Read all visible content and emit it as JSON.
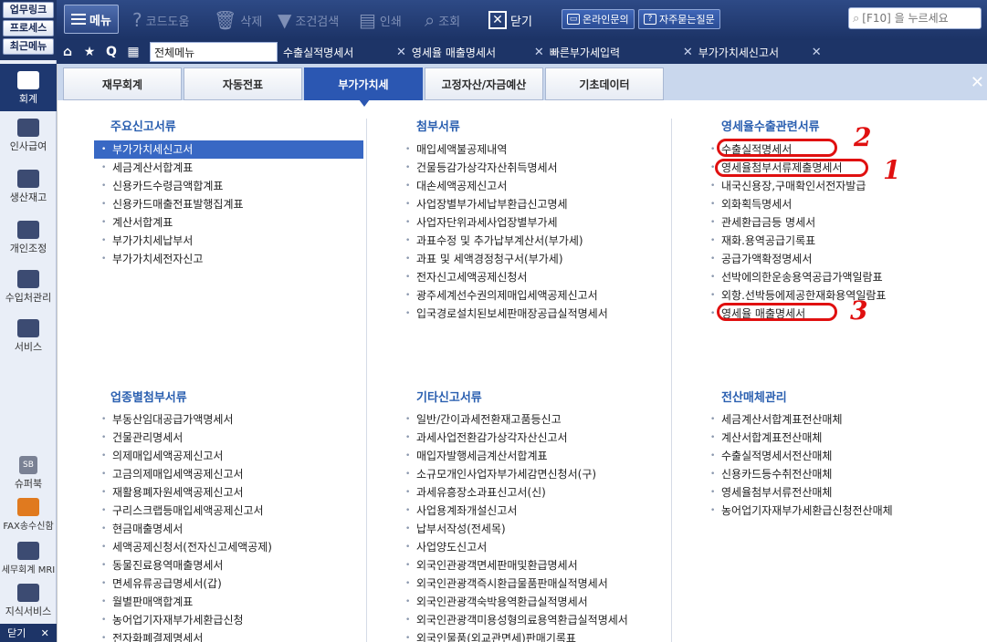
{
  "quick_buttons": [
    "업무링크",
    "프로세스",
    "최근메뉴"
  ],
  "toolbar": {
    "menu_label": "메뉴",
    "code_help": "코드도움",
    "delete": "삭제",
    "filter": "조건검색",
    "print": "인쇄",
    "lookup": "조회",
    "close": "닫기",
    "online_inquiry": "온라인문의",
    "faq": "자주묻는질문",
    "search_placeholder": "[F10] 을 누르세요"
  },
  "tabs": {
    "all_menu": "전체메뉴",
    "docs": [
      "수출실적명세서",
      "영세율 매출명세서",
      "빠른부가세입력",
      "부가가치세신고서"
    ]
  },
  "sidebar": {
    "items": [
      "회계",
      "인사급여",
      "생산재고",
      "개인조정",
      "수입처관리",
      "서비스"
    ],
    "lower": [
      "슈퍼북",
      "FAX송수신함",
      "세무회계 MRI",
      "지식서비스"
    ],
    "superbook_badge": "SB",
    "close_label": "닫기"
  },
  "categories": [
    "재무회계",
    "자동전표",
    "부가가치세",
    "고정자산/자금예산",
    "기초데이터"
  ],
  "sections": {
    "main_returns": {
      "title": "주요신고서류",
      "items": [
        "부가가치세신고서",
        "세금계산서합계표",
        "신용카드수령금액합계표",
        "신용카드매출전표발행집계표",
        "계산서합계표",
        "부가가치세납부서",
        "부가가치세전자신고"
      ]
    },
    "attachments": {
      "title": "첨부서류",
      "items": [
        "매입세액불공제내역",
        "건물등감가상각자산취득명세서",
        "대손세액공제신고서",
        "사업장별부가세납부환급신고명세",
        "사업자단위과세사업장별부가세",
        "과표수정 및 추가납부계산서(부가세)",
        "과표 및 세액경정청구서(부가세)",
        "전자신고세액공제신청서",
        "광주세계선수권의제매입세액공제신고서",
        "입국경로설치된보세판매장공급실적명세서"
      ]
    },
    "zero_rate": {
      "title": "영세율수출관련서류",
      "items": [
        "수출실적명세서",
        "영세율첨부서류제출명세서",
        "내국신용장,구매확인서전자발급",
        "외화획득명세서",
        "관세환급금등 명세서",
        "재화.용역공급기록표",
        "공급가액확정명세서",
        "선박에의한운송용역공급가액일람표",
        "외항.선박등에제공한재화용역일람표",
        "영세율 매출명세서"
      ]
    },
    "industry": {
      "title": "업종별첨부서류",
      "items": [
        "부동산임대공급가액명세서",
        "건물관리명세서",
        "의제매입세액공제신고서",
        "고금의제매입세액공제신고서",
        "재활용폐자원세액공제신고서",
        "구리스크랩등매입세액공제신고서",
        "현금매출명세서",
        "세액공제신청서(전자신고세액공제)",
        "동물진료용역매출명세서",
        "면세유류공급명세서(갑)",
        "월별판매액합계표",
        "농어업기자재부가세환급신청",
        "전자화폐결제명세서"
      ]
    },
    "other": {
      "title": "기타신고서류",
      "items": [
        "일반/간이과세전환재고품등신고",
        "과세사업전환감가상각자산신고서",
        "매입자발행세금계산서합계표",
        "소규모개인사업자부가세감면신청서(구)",
        "과세유흥장소과표신고서(신)",
        "사업용계좌개설신고서",
        "납부서작성(전세목)",
        "사업양도신고서",
        "외국인관광객면세판매및환급명세서",
        "외국인관광객즉시환급물품판매실적명세서",
        "외국인관광객숙박용역환급실적명세서",
        "외국인관광객미용성형의료용역환급실적명세서",
        "외국인물품(외교관면세)판매기록표"
      ]
    },
    "electronic": {
      "title": "전산매체관리",
      "items": [
        "세금계산서합계표전산매체",
        "계산서합계표전산매체",
        "수출실적명세서전산매체",
        "신용카드등수취전산매체",
        "영세율첨부서류전산매체",
        "농어업기자재부가세환급신청전산매체"
      ]
    }
  },
  "annotations": [
    "2",
    "1",
    "3"
  ],
  "colors": {
    "accent": "#2b57b2",
    "annotation": "#e01010",
    "header": "#1d3467"
  }
}
